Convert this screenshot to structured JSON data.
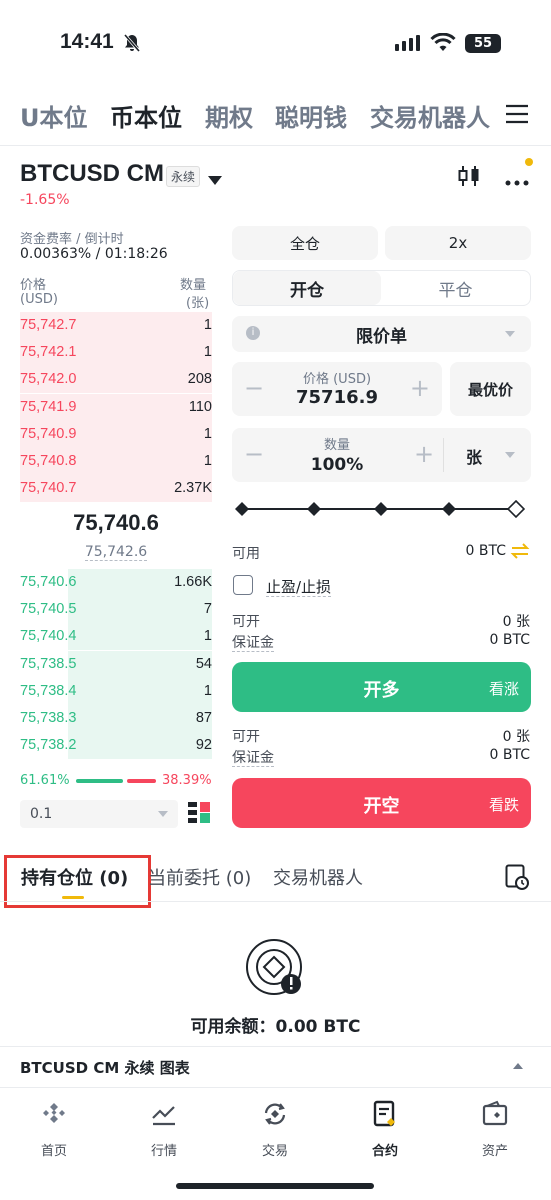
{
  "status_bar": {
    "time": "14:41",
    "battery": "55"
  },
  "top_tabs": [
    "U本位",
    "币本位",
    "期权",
    "聪明钱",
    "交易机器人"
  ],
  "header": {
    "symbol": "BTCUSD CM",
    "badge": "永续",
    "change": "-1.65%"
  },
  "funding": {
    "label": "资金费率 / 倒计时",
    "value": "0.00363% / 01:18:26"
  },
  "orderbook": {
    "price_header": "价格",
    "price_unit": "(USD)",
    "qty_header": "数量",
    "qty_unit": "(张)",
    "asks": [
      {
        "price": "75,742.7",
        "qty": "1",
        "depth": 1.0
      },
      {
        "price": "75,742.1",
        "qty": "1",
        "depth": 1.0
      },
      {
        "price": "75,742.0",
        "qty": "208",
        "depth": 1.0
      },
      {
        "price": "75,741.9",
        "qty": "110",
        "depth": 1.0
      },
      {
        "price": "75,740.9",
        "qty": "1",
        "depth": 1.0
      },
      {
        "price": "75,740.8",
        "qty": "1",
        "depth": 1.0
      },
      {
        "price": "75,740.7",
        "qty": "2.37K",
        "depth": 1.0
      }
    ],
    "last_price": "75,740.6",
    "mark_price": "75,742.6",
    "bids": [
      {
        "price": "75,740.6",
        "qty": "1.66K",
        "depth": 0.75
      },
      {
        "price": "75,740.5",
        "qty": "7",
        "depth": 0.75
      },
      {
        "price": "75,740.4",
        "qty": "1",
        "depth": 0.75
      },
      {
        "price": "75,738.5",
        "qty": "54",
        "depth": 0.75
      },
      {
        "price": "75,738.4",
        "qty": "1",
        "depth": 0.75
      },
      {
        "price": "75,738.3",
        "qty": "87",
        "depth": 0.75
      },
      {
        "price": "75,738.2",
        "qty": "92",
        "depth": 0.75
      }
    ],
    "buy_ratio": "61.61%",
    "sell_ratio": "38.39%",
    "buy_ratio_value": 0.6161,
    "precision": "0.1"
  },
  "order_form": {
    "margin_mode": "全仓",
    "leverage": "2x",
    "open_tab": "开仓",
    "close_tab": "平仓",
    "order_type": "限价单",
    "price_label": "价格 (USD)",
    "price_value": "75716.9",
    "best_price": "最优价",
    "qty_label": "数量",
    "qty_value": "100%",
    "qty_unit": "张",
    "slider_percent": 100,
    "available_label": "可用",
    "available_value": "0 BTC",
    "tpsl_label": "止盈/止损",
    "long": {
      "open_label": "可开",
      "open_val": "0 张",
      "margin_label": "保证金",
      "margin_val": "0 BTC",
      "button": "开多",
      "hint": "看涨"
    },
    "short": {
      "open_label": "可开",
      "open_val": "0 张",
      "margin_label": "保证金",
      "margin_val": "0 BTC",
      "button": "开空",
      "hint": "看跌"
    }
  },
  "positions": {
    "tabs": [
      "持有仓位 (0)",
      "当前委托 (0)",
      "交易机器人"
    ],
    "empty_text": "可用余额：0.00 BTC"
  },
  "chart_bar": {
    "label": "BTCUSD CM 永续 图表"
  },
  "bottom_nav": [
    "首页",
    "行情",
    "交易",
    "合约",
    "资产"
  ],
  "colors": {
    "up": "#2ebd85",
    "down": "#f6465d",
    "brand": "#f0b90b",
    "highlight_box": "#e53935"
  }
}
